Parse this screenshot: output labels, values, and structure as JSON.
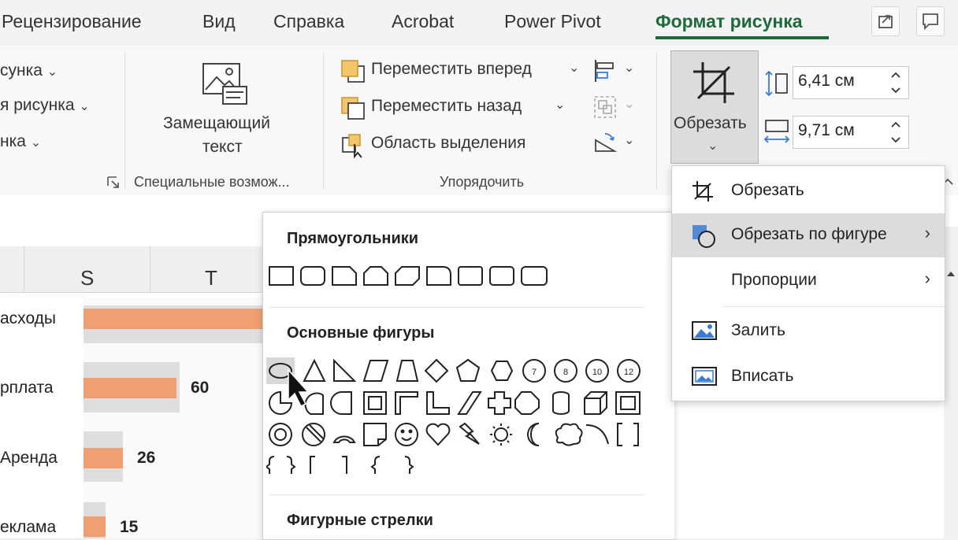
{
  "tabs": {
    "review": "Рецензирование",
    "view": "Вид",
    "help": "Справка",
    "acrobat": "Acrobat",
    "power_pivot": "Power Pivot",
    "picture_format": "Формат рисунка",
    "share_icon": "share-icon",
    "comments_icon": "comment-icon"
  },
  "ribbon": {
    "left_items": [
      "сунка",
      "я рисунка",
      "нка"
    ],
    "alt_text": {
      "line1": "Замещающий",
      "line2": "текст"
    },
    "accessibility_group": "Специальные возмож...",
    "arrange": {
      "bring_forward": "Переместить вперед",
      "send_backward": "Переместить назад",
      "selection_pane": "Область выделения",
      "group_label": "Упорядочить"
    },
    "crop_button": "Обрезать",
    "height_value": "6,41 см",
    "width_value": "9,71 см"
  },
  "sheet": {
    "columns": [
      "S",
      "T"
    ],
    "rows": [
      {
        "label": "асходы",
        "value": ""
      },
      {
        "label": "рплата",
        "value": "60"
      },
      {
        "label": "Аренда",
        "value": "26"
      },
      {
        "label": "еклама",
        "value": "15"
      }
    ]
  },
  "shapes_panel": {
    "rectangles_header": "Прямоугольники",
    "basic_header": "Основные фигуры",
    "arrows_header": "Фигурные стрелки",
    "basic_numbers": [
      "7",
      "8",
      "10",
      "12"
    ]
  },
  "crop_menu": {
    "items": [
      {
        "label": "Обрезать",
        "icon": "crop-icon"
      },
      {
        "label": "Обрезать по фигуре",
        "icon": "crop-to-shape-icon"
      },
      {
        "label": "Пропорции",
        "icon": ""
      },
      {
        "label": "Залить",
        "icon": "fill-icon"
      },
      {
        "label": "Вписать",
        "icon": "fit-icon"
      }
    ]
  },
  "colors": {
    "accent": "#1d6b3a",
    "bar": "#ef9f72",
    "bar_bg": "#dedede"
  }
}
